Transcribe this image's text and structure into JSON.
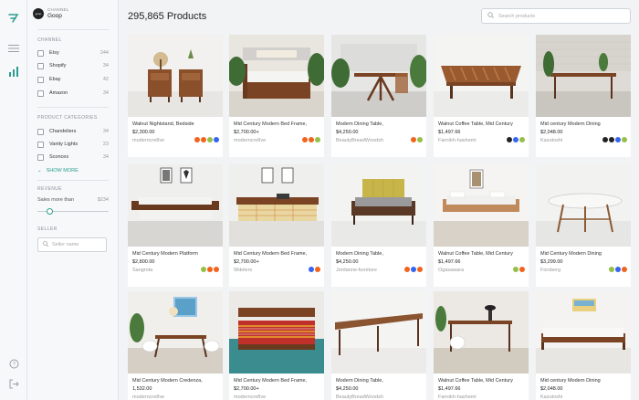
{
  "brand": {
    "accent": "#2a9d8f"
  },
  "channel": {
    "label": "CHANNEL",
    "name": "Goop",
    "logo_text": "goop"
  },
  "filters": {
    "channel_heading": "CHANNEL",
    "channels": [
      {
        "label": "Etsy",
        "count": "244"
      },
      {
        "label": "Shopify",
        "count": "34"
      },
      {
        "label": "Ebay",
        "count": "42"
      },
      {
        "label": "Amazon",
        "count": "34"
      }
    ],
    "category_heading": "PRODUCT CATEGORIES",
    "categories": [
      {
        "label": "Chandeliers",
        "count": "34"
      },
      {
        "label": "Vanity Lights",
        "count": "23"
      },
      {
        "label": "Sconces",
        "count": "34"
      }
    ],
    "show_more": "SHOW MORE",
    "revenue_heading": "REVENUE",
    "sales_more_than": "Sales more than",
    "sales_value": "$234",
    "slider_value_fraction": 0.12,
    "seller_heading": "SELLER",
    "seller_placeholder": "Seller name"
  },
  "header": {
    "title": "295,865 Products",
    "search_placeholder": "Search products"
  },
  "badge_colors": {
    "etsy": "#f1641e",
    "shopify": "#95bf47",
    "ebay": "#3665f3",
    "amazon": "#ff9900",
    "dark": "#222222"
  },
  "products": [
    {
      "title": "Walnut Nightstand, Bedside",
      "price": "$2,300.00",
      "seller": "moderncre8ve",
      "badges": [
        "etsy",
        "etsy",
        "shopify",
        "ebay"
      ],
      "scene": "nightstand"
    },
    {
      "title": "Mid Century Modern Bed Frame,",
      "price": "$2,700.00+",
      "seller": "moderncre8ve",
      "badges": [
        "etsy",
        "etsy",
        "shopify"
      ],
      "scene": "bed-plants"
    },
    {
      "title": "Modern Dining Table,",
      "price": "$4,250.00",
      "seller": "BeautyBreadWoodsh",
      "badges": [
        "etsy",
        "shopify"
      ],
      "scene": "table-plants"
    },
    {
      "title": "Walnut Coffee Table, Mid Century",
      "price": "$1,497.66",
      "seller": "Farrokh-hashemi",
      "badges": [
        "dark",
        "ebay",
        "shopify"
      ],
      "scene": "coffee"
    },
    {
      "title": "Mid century Modern Dining",
      "price": "$2,048.00",
      "seller": "Kazutoshi",
      "badges": [
        "dark",
        "dark",
        "ebay",
        "shopify"
      ],
      "scene": "dining-brick"
    },
    {
      "title": "Mid Century Modern Platform",
      "price": "$2,800.00",
      "seller": "Sangrota",
      "badges": [
        "shopify",
        "etsy",
        "etsy"
      ],
      "scene": "platform-bed"
    },
    {
      "title": "Mid Century Modern Bed Frame,",
      "price": "$2,700.00+",
      "seller": "Wdelers",
      "badges": [
        "ebay",
        "etsy"
      ],
      "scene": "bed-plaid"
    },
    {
      "title": "Modern Dining Table,",
      "price": "$4,250.00",
      "seller": "Jordanne-furniture",
      "badges": [
        "etsy",
        "ebay",
        "etsy"
      ],
      "scene": "bed-yellow"
    },
    {
      "title": "Walnut Coffee Table, Mid Century",
      "price": "$1,497.66",
      "seller": "Ogasawara",
      "badges": [
        "shopify",
        "etsy"
      ],
      "scene": "bed-white"
    },
    {
      "title": "Mid Century Modern Dining",
      "price": "$3,299.00",
      "seller": "Forsberg",
      "badges": [
        "shopify",
        "ebay",
        "etsy"
      ],
      "scene": "round-table"
    },
    {
      "title": "Mid Century Modern Credenza,",
      "price": "1,532.00",
      "seller": "moderncre8ve",
      "badges": [],
      "scene": "dining-room"
    },
    {
      "title": "Mid Century Modern Bed Frame,",
      "price": "$2,700.00+",
      "seller": "moderncre8ve",
      "badges": [],
      "scene": "bed-red"
    },
    {
      "title": "Modern Dining Table,",
      "price": "$4,250.00",
      "seller": "BeautyBreadWoodsh",
      "badges": [],
      "scene": "long-table"
    },
    {
      "title": "Walnut Coffee Table, Mid Century",
      "price": "$1,497.66",
      "seller": "Farrokh-hashemi",
      "badges": [],
      "scene": "desk"
    },
    {
      "title": "Mid century Modern Dining",
      "price": "$2,048.00",
      "seller": "Kazutoshi",
      "badges": [],
      "scene": "low-bed"
    }
  ]
}
